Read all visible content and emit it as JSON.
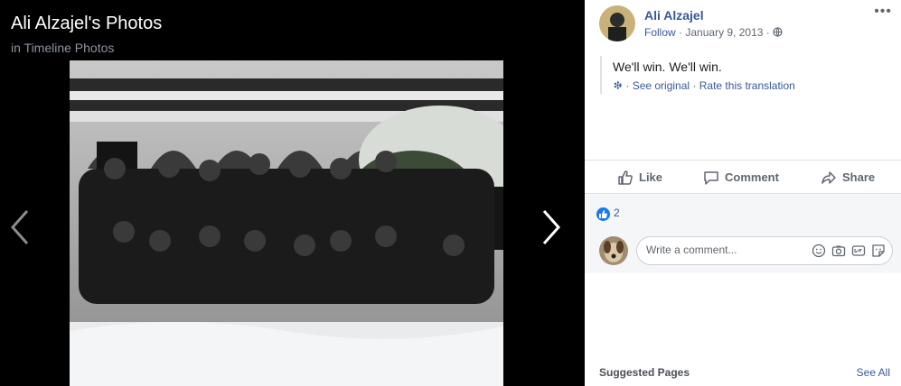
{
  "viewer": {
    "title": "Ali Alzajel's Photos",
    "subtitle": "in Timeline Photos"
  },
  "post": {
    "author": "Ali Alzajel",
    "follow": "Follow",
    "date": "January 9, 2013",
    "sep": "·",
    "text": "We'll win. We'll win.",
    "see_original": "See original",
    "rate_translation": "Rate this translation"
  },
  "actions": {
    "like": "Like",
    "comment": "Comment",
    "share": "Share"
  },
  "reactions": {
    "count": "2"
  },
  "comment": {
    "placeholder": "Write a comment..."
  },
  "suggested": {
    "title": "Suggested Pages",
    "see_all": "See All"
  },
  "icons": {
    "globe": "globe-icon",
    "more": "ellipsis-icon",
    "like": "thumbs-up-icon",
    "comment": "speech-bubble-icon",
    "share": "share-arrow-icon",
    "emoji": "smiley-icon",
    "camera": "camera-icon",
    "gif": "gif-icon",
    "sticker": "sticker-icon",
    "prev": "chevron-left-icon",
    "next": "chevron-right-icon",
    "gear": "gear-icon"
  },
  "colors": {
    "link": "#385898",
    "like_blue": "#1877f2",
    "viewer_bg": "#000000",
    "panel_bg": "#ffffff"
  }
}
